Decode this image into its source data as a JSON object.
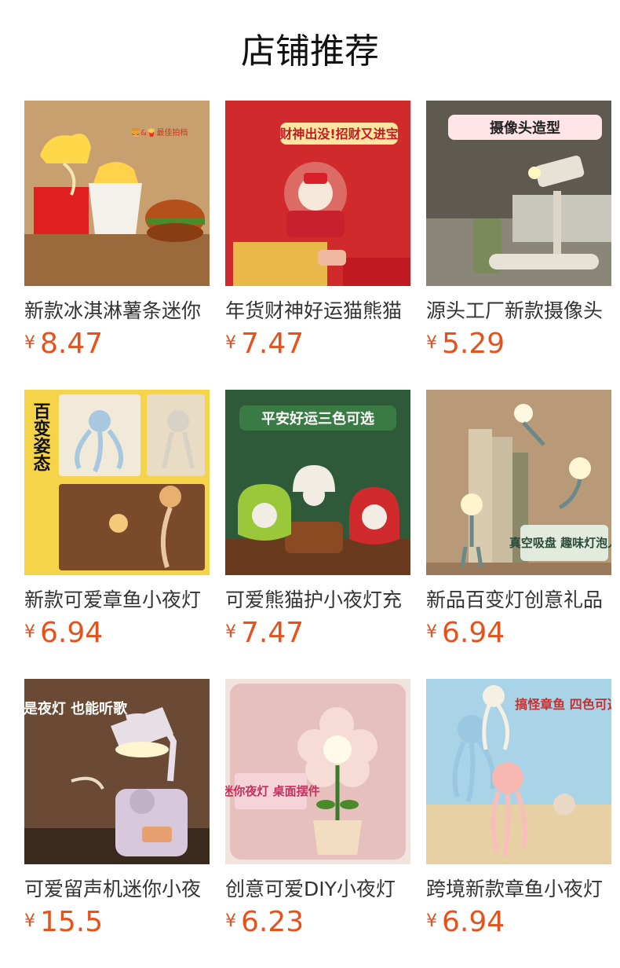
{
  "header": {
    "title": "店铺推荐"
  },
  "colors": {
    "price": "#e4521d",
    "title": "#111111",
    "name": "#333333"
  },
  "products": [
    {
      "name": "新款冰淇淋薯条迷你",
      "currency": "¥",
      "price": "8.47",
      "image": {
        "icon": "fries-burger-lamp-icon",
        "tag": "🍔&🍟最佳拍档",
        "bg": "#b07a4a"
      }
    },
    {
      "name": "年货财神好运猫熊猫",
      "currency": "¥",
      "price": "7.47",
      "image": {
        "icon": "fortune-god-lamp-icon",
        "tag": "财神出没!招财又进宝",
        "bg": "#c8202c"
      }
    },
    {
      "name": "源头工厂新款摄像头",
      "currency": "¥",
      "price": "5.29",
      "image": {
        "icon": "camera-lamp-icon",
        "tag": "摄像头造型",
        "bg": "#6e6a5e"
      }
    },
    {
      "name": "新款可爱章鱼小夜灯",
      "currency": "¥",
      "price": "6.94",
      "image": {
        "icon": "octopus-lamp-icon",
        "tag": "百变姿态",
        "bg": "#f6d24a"
      }
    },
    {
      "name": "可爱熊猫护小夜灯充",
      "currency": "¥",
      "price": "7.47",
      "image": {
        "icon": "panda-apple-lamp-icon",
        "tag": "平安好运三色可选",
        "bg": "#2f5a3a"
      }
    },
    {
      "name": "新品百变灯创意礼品",
      "currency": "¥",
      "price": "6.94",
      "image": {
        "icon": "suction-bulb-lamp-icon",
        "tag": "真空吸盘 趣味灯泡人",
        "bg": "#b69a78"
      }
    },
    {
      "name": "可爱留声机迷你小夜",
      "currency": "¥",
      "price": "15.5",
      "image": {
        "icon": "gramophone-lamp-icon",
        "tag": "既是夜灯 也能听歌",
        "bg": "#6b4a32"
      }
    },
    {
      "name": "创意可爱DIY小夜灯",
      "currency": "¥",
      "price": "6.23",
      "image": {
        "icon": "flower-lamp-icon",
        "tag": "迷你夜灯 桌面摆件",
        "bg": "#e9c3c0"
      }
    },
    {
      "name": "跨境新款章鱼小夜灯",
      "currency": "¥",
      "price": "6.94",
      "image": {
        "icon": "octopus-beach-lamp-icon",
        "tag": "搞怪章鱼 四色可选",
        "bg": "#a9d3e6"
      }
    }
  ]
}
